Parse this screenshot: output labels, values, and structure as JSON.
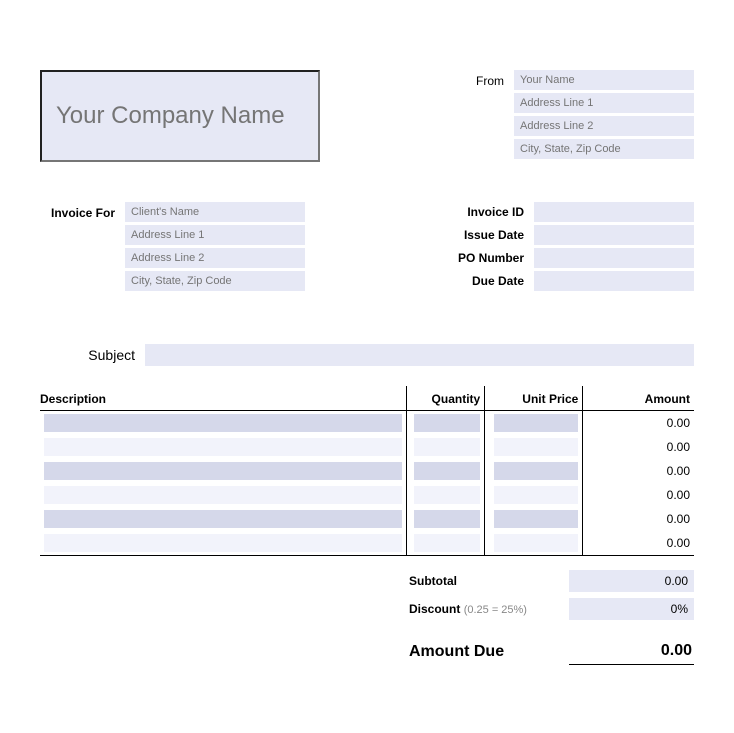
{
  "company_name_placeholder": "Your Company Name",
  "from_label": "From",
  "from_fields": {
    "name": "Your Name",
    "addr1": "Address Line 1",
    "addr2": "Address Line 2",
    "csz": "City, State, Zip Code"
  },
  "invoice_for_label": "Invoice For",
  "client_fields": {
    "name": "Client's Name",
    "addr1": "Address Line 1",
    "addr2": "Address Line 2",
    "csz": "City, State, Zip Code"
  },
  "meta": {
    "invoice_id_label": "Invoice ID",
    "issue_date_label": "Issue Date",
    "po_number_label": "PO Number",
    "due_date_label": "Due Date"
  },
  "subject_label": "Subject",
  "table_headers": {
    "description": "Description",
    "quantity": "Quantity",
    "unit_price": "Unit Price",
    "amount": "Amount"
  },
  "line_items": [
    {
      "amount": "0.00"
    },
    {
      "amount": "0.00"
    },
    {
      "amount": "0.00"
    },
    {
      "amount": "0.00"
    },
    {
      "amount": "0.00"
    },
    {
      "amount": "0.00"
    }
  ],
  "totals": {
    "subtotal_label": "Subtotal",
    "subtotal_value": "0.00",
    "discount_label": "Discount",
    "discount_hint": "(0.25 = 25%)",
    "discount_value": "0%",
    "amount_due_label": "Amount Due",
    "amount_due_value": "0.00"
  }
}
